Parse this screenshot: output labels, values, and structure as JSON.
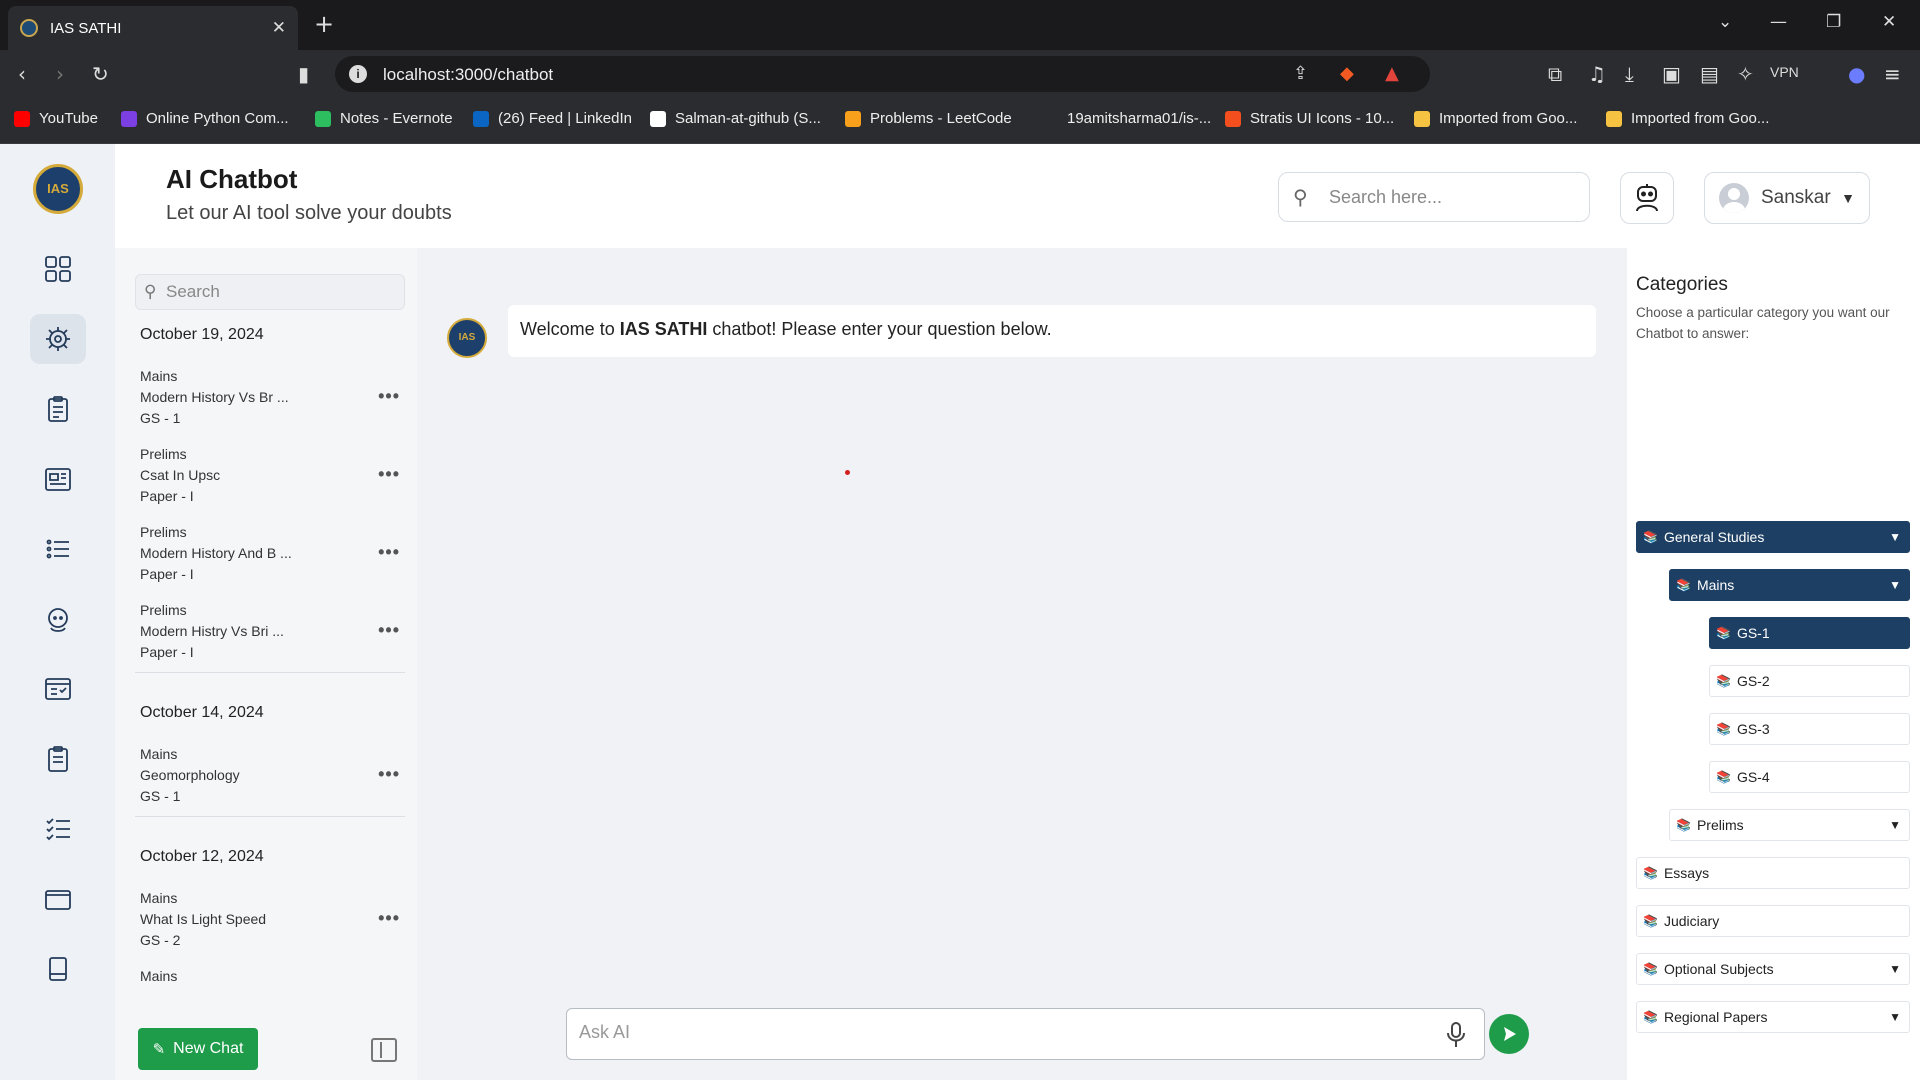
{
  "browser": {
    "tab_title": "IAS SATHI",
    "url": "localhost:3000/chatbot",
    "vpn_label": "VPN",
    "notification_count": "1",
    "bookmarks": [
      {
        "label": "YouTube",
        "color": "#ff0000"
      },
      {
        "label": "Online Python Com...",
        "color": "#7b3fe4"
      },
      {
        "label": "Notes - Evernote",
        "color": "#2dbe60"
      },
      {
        "label": "(26) Feed | LinkedIn",
        "color": "#0a66c2"
      },
      {
        "label": "Salman-at-github (S...",
        "color": "#ffffff"
      },
      {
        "label": "Problems - LeetCode",
        "color": "#f89f1b"
      },
      {
        "label": "19amitsharma01/is-...",
        "color": "#2b2c2f"
      },
      {
        "label": "Stratis UI Icons - 10...",
        "color": "#f24e1e"
      },
      {
        "label": "Imported from Goo...",
        "color": "#f5c242"
      },
      {
        "label": "Imported from Goo...",
        "color": "#f5c242"
      }
    ]
  },
  "app": {
    "logo_text": "IAS SATHI",
    "title": "AI Chatbot",
    "subtitle": "Let our AI tool solve your doubts",
    "search_placeholder": "Search here...",
    "user_name": "Sanskar",
    "accent_color": "#1e9c4a",
    "navy_color": "#1d3f63"
  },
  "rail": [
    {
      "icon": "dashboard-grid-icon"
    },
    {
      "icon": "ai-brain-icon",
      "active": true
    },
    {
      "icon": "test-clipboard-icon"
    },
    {
      "icon": "newspaper-icon"
    },
    {
      "icon": "list-icon"
    },
    {
      "icon": "mentor-avatar-icon"
    },
    {
      "icon": "checklist-window-icon"
    },
    {
      "icon": "notes-clipboard-icon"
    },
    {
      "icon": "task-list-icon"
    },
    {
      "icon": "wallet-icon"
    },
    {
      "icon": "book-icon"
    }
  ],
  "history": {
    "search_placeholder": "Search",
    "new_chat_label": "New Chat",
    "groups": [
      {
        "date": "October 19, 2024",
        "items": [
          {
            "l1": "Mains",
            "l2": "Modern History Vs Br ...",
            "l3": "GS - 1"
          },
          {
            "l1": "Prelims",
            "l2": "Csat In Upsc",
            "l3": "Paper - I"
          },
          {
            "l1": "Prelims",
            "l2": "Modern History And B ...",
            "l3": "Paper - I"
          },
          {
            "l1": "Prelims",
            "l2": "Modern Histry Vs Bri ...",
            "l3": "Paper - I"
          }
        ]
      },
      {
        "date": "October 14, 2024",
        "items": [
          {
            "l1": "Mains",
            "l2": "Geomorphology",
            "l3": "GS - 1"
          }
        ]
      },
      {
        "date": "October 12, 2024",
        "items": [
          {
            "l1": "Mains",
            "l2": "What Is Light Speed",
            "l3": "GS - 2"
          },
          {
            "l1": "Mains",
            "l2": "",
            "l3": ""
          }
        ]
      }
    ]
  },
  "chat": {
    "welcome_prefix": "Welcome to ",
    "welcome_bold": "IAS SATHI",
    "welcome_suffix": " chatbot! Please enter your question below.",
    "ask_placeholder": "Ask AI"
  },
  "categories": {
    "title": "Categories",
    "description": "Choose a particular category you want our Chatbot to answer:",
    "items": [
      {
        "label": "General Studies",
        "dropdown": true,
        "selected": true
      },
      {
        "label": "Mains",
        "dropdown": true,
        "selected": true
      },
      {
        "label": "GS-1",
        "selected": true
      },
      {
        "label": "GS-2"
      },
      {
        "label": "GS-3"
      },
      {
        "label": "GS-4"
      },
      {
        "label": "Prelims",
        "dropdown": true
      },
      {
        "label": "Essays"
      },
      {
        "label": "Judiciary"
      },
      {
        "label": "Optional Subjects",
        "dropdown": true
      },
      {
        "label": "Regional Papers",
        "dropdown": true
      }
    ]
  }
}
